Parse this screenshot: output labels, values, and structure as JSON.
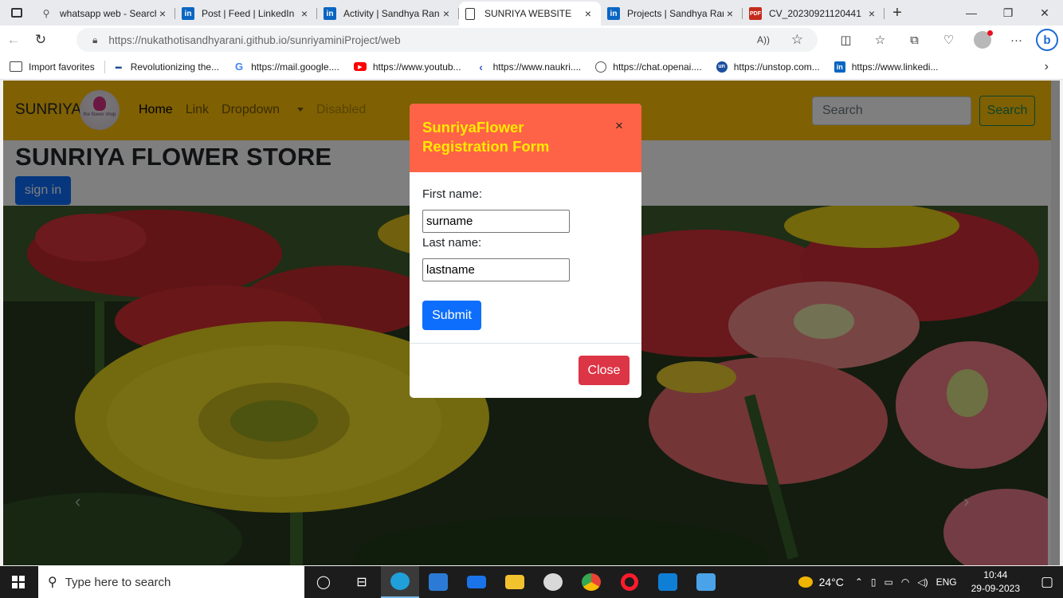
{
  "browser": {
    "tabs": [
      {
        "label": "whatsapp web - Search",
        "icon": "search-icon"
      },
      {
        "label": "Post | Feed | LinkedIn",
        "icon": "linkedin-icon"
      },
      {
        "label": "Activity | Sandhya Rani",
        "icon": "linkedin-icon"
      },
      {
        "label": "SUNRIYA WEBSITE",
        "icon": "page-icon",
        "active": true
      },
      {
        "label": "Projects | Sandhya Rani",
        "icon": "linkedin-icon"
      },
      {
        "label": "CV_20230921120441",
        "icon": "pdf-icon"
      }
    ],
    "url_host": "https://nukathotisandhyarani.github.io",
    "url_path": "/sunriyaminiProject/web",
    "favorites": [
      {
        "label": "Import favorites",
        "icon": "import-icon"
      },
      {
        "label": "Revolutionizing the...",
        "icon": "site-icon"
      },
      {
        "label": "https://mail.google....",
        "icon": "google-icon"
      },
      {
        "label": "https://www.youtub...",
        "icon": "youtube-icon"
      },
      {
        "label": "https://www.naukri....",
        "icon": "naukri-icon"
      },
      {
        "label": "https://chat.openai....",
        "icon": "openai-icon"
      },
      {
        "label": "https://unstop.com...",
        "icon": "unstop-icon"
      },
      {
        "label": "https://www.linkedi...",
        "icon": "linkedin-icon"
      }
    ]
  },
  "site": {
    "brand": "SUNRIYA",
    "logo_text": "the flower shop",
    "nav": {
      "home": "Home",
      "link": "Link",
      "dropdown": "Dropdown",
      "disabled": "Disabled"
    },
    "search_placeholder": "Search",
    "search_button": "Search",
    "title": "SUNRIYA FLOWER STORE",
    "signin": "sign in",
    "carousel_prev": "‹",
    "carousel_next": "›"
  },
  "modal": {
    "title": "SunriyaFlower Registration Form",
    "close_x": "×",
    "first_label": "First name:",
    "first_value": "surname",
    "last_label": "Last name:",
    "last_value": "lastname",
    "submit": "Submit",
    "close": "Close"
  },
  "taskbar": {
    "search_placeholder": "Type here to search",
    "weather": "24°C",
    "lang": "ENG",
    "time": "10:44",
    "date": "29-09-2023"
  },
  "colors": {
    "navbar": "#ffc107",
    "modal_header": "#ff6347",
    "modal_title": "#ffea00",
    "primary": "#0d6efd",
    "danger": "#dc3545"
  }
}
